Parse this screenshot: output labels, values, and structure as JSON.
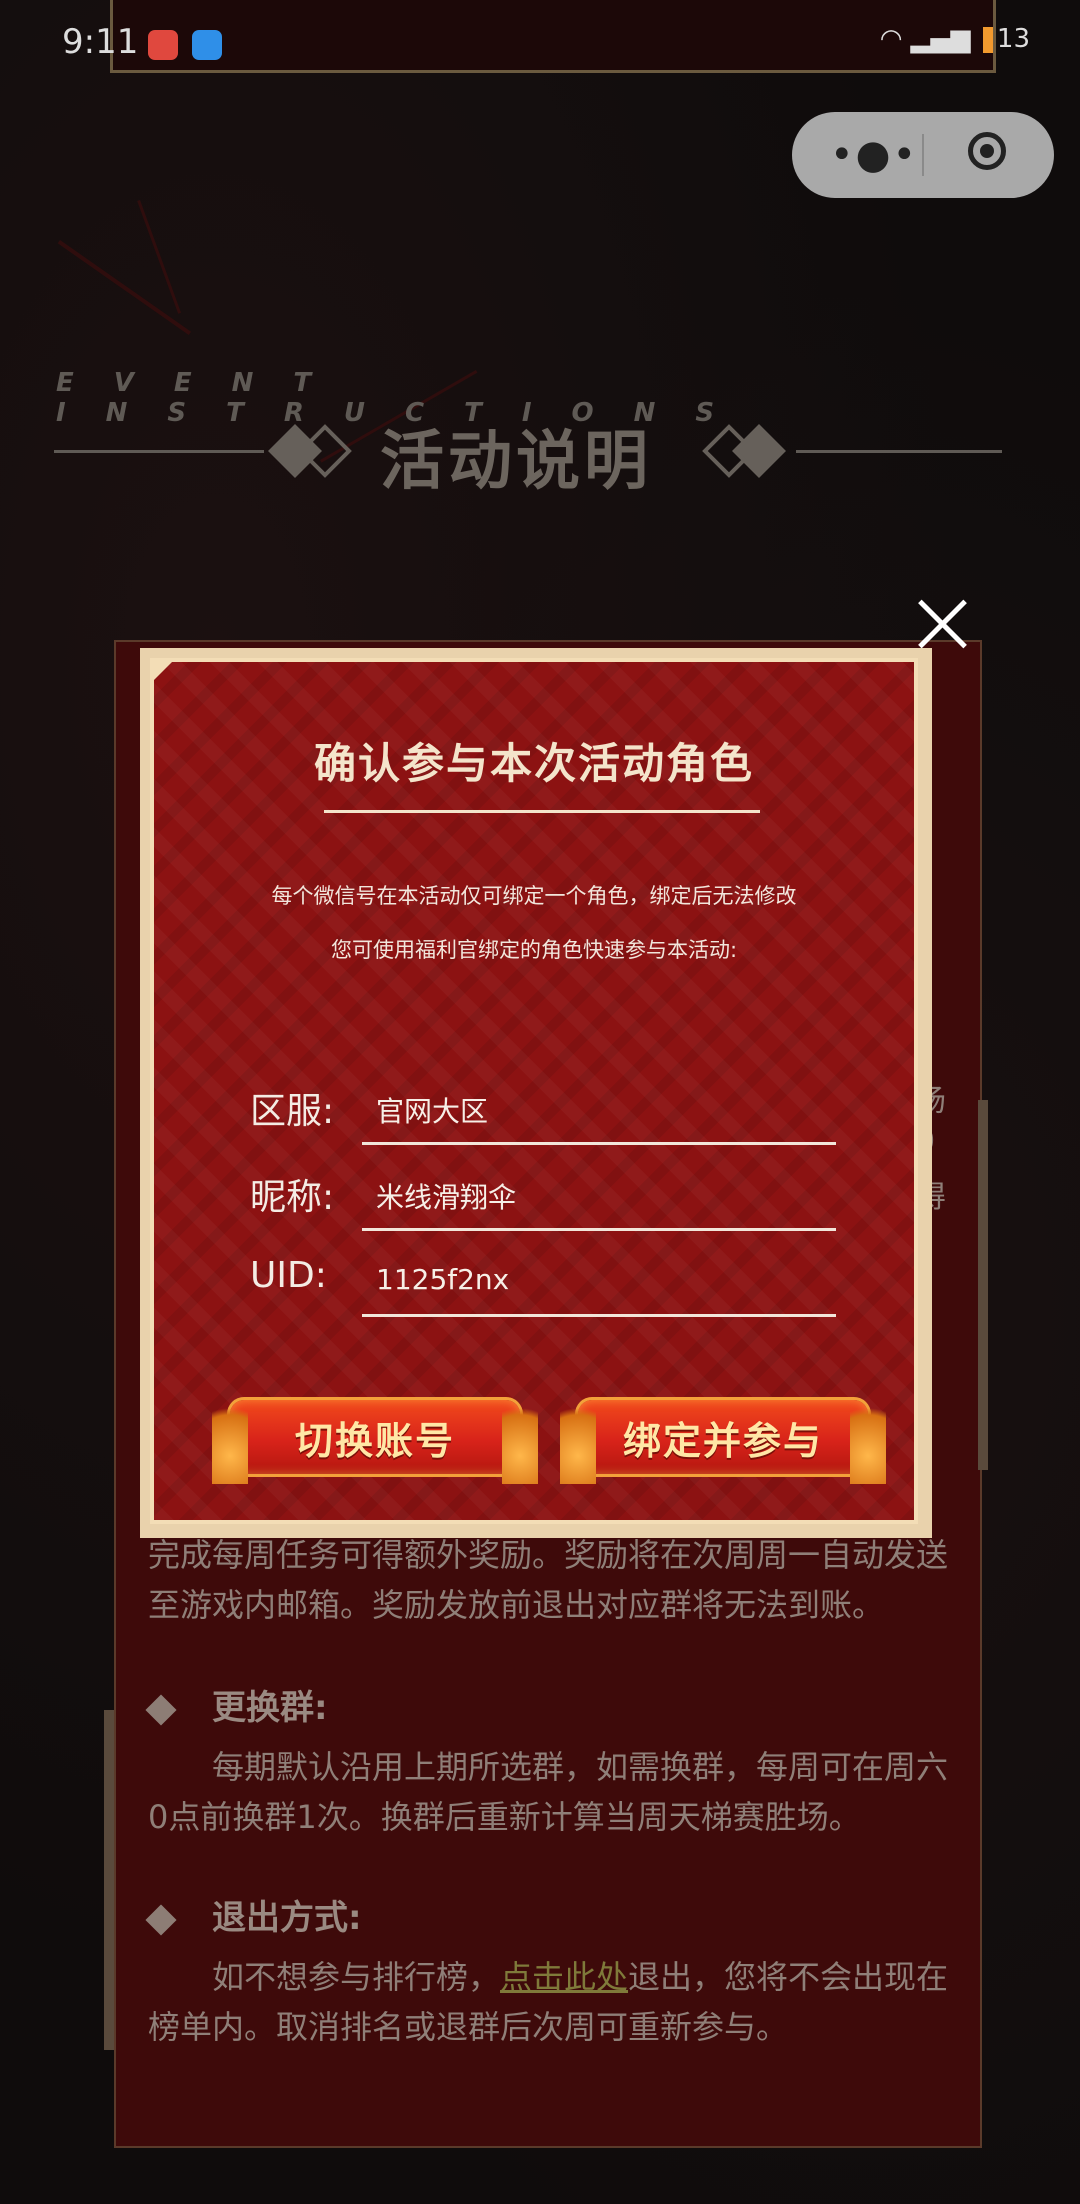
{
  "status_bar": {
    "time": "9:11",
    "battery": "13"
  },
  "heading": {
    "english": "EVENT INSTRUCTIONS",
    "chinese": "活动说明"
  },
  "rules": {
    "edge_chars": [
      "场",
      "0",
      "得"
    ],
    "weekly_text": "完成每周任务可得额外奖励。奖励将在次周周一自动发送至游戏内邮箱。奖励发放前退出对应群将无法到账。",
    "change_group_title": "更换群:",
    "change_group_text": "每期默认沿用上期所选群，如需换群，每周可在周六0点前换群1次。换群后重新计算当周天梯赛胜场。",
    "exit_title": "退出方式:",
    "exit_text_before": "如不想参与排行榜，",
    "exit_link": "点击此处",
    "exit_text_after": "退出，您将不会出现在榜单内。取消排名或退群后次周可重新参与。"
  },
  "modal": {
    "title": "确认参与本次活动角色",
    "note_1": "每个微信号在本活动仅可绑定一个角色，绑定后无法修改",
    "note_2": "您可使用福利官绑定的角色快速参与本活动:",
    "fields": [
      {
        "label": "区服:",
        "value": "官网大区"
      },
      {
        "label": "昵称:",
        "value": "米线滑翔伞"
      },
      {
        "label": "UID:",
        "value": "1125f2nx"
      }
    ],
    "switch_button": "切换账号",
    "bind_button": "绑定并参与"
  }
}
